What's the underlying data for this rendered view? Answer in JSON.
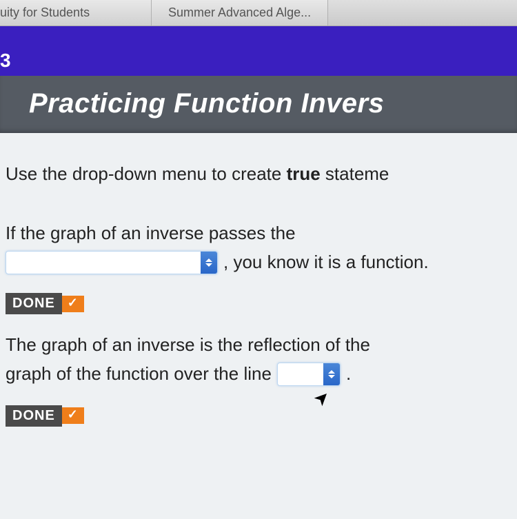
{
  "tabs": {
    "tab1": "uity for Students",
    "tab2": "Summer Advanced Alge..."
  },
  "purple_bar": {
    "letter": "3"
  },
  "title": "Practicing Function Invers",
  "content": {
    "instruction_prefix": "Use the drop-down menu to create ",
    "instruction_bold": "true",
    "instruction_suffix": " stateme",
    "q1_line1": "If the graph of an inverse passes the",
    "q1_after_dropdown": ", you know it is a function.",
    "done_label": "DONE",
    "q2_line1": "The graph of an inverse is the reflection of the",
    "q2_line2_prefix": "graph of the function over the line",
    "q2_after_dropdown": "."
  }
}
